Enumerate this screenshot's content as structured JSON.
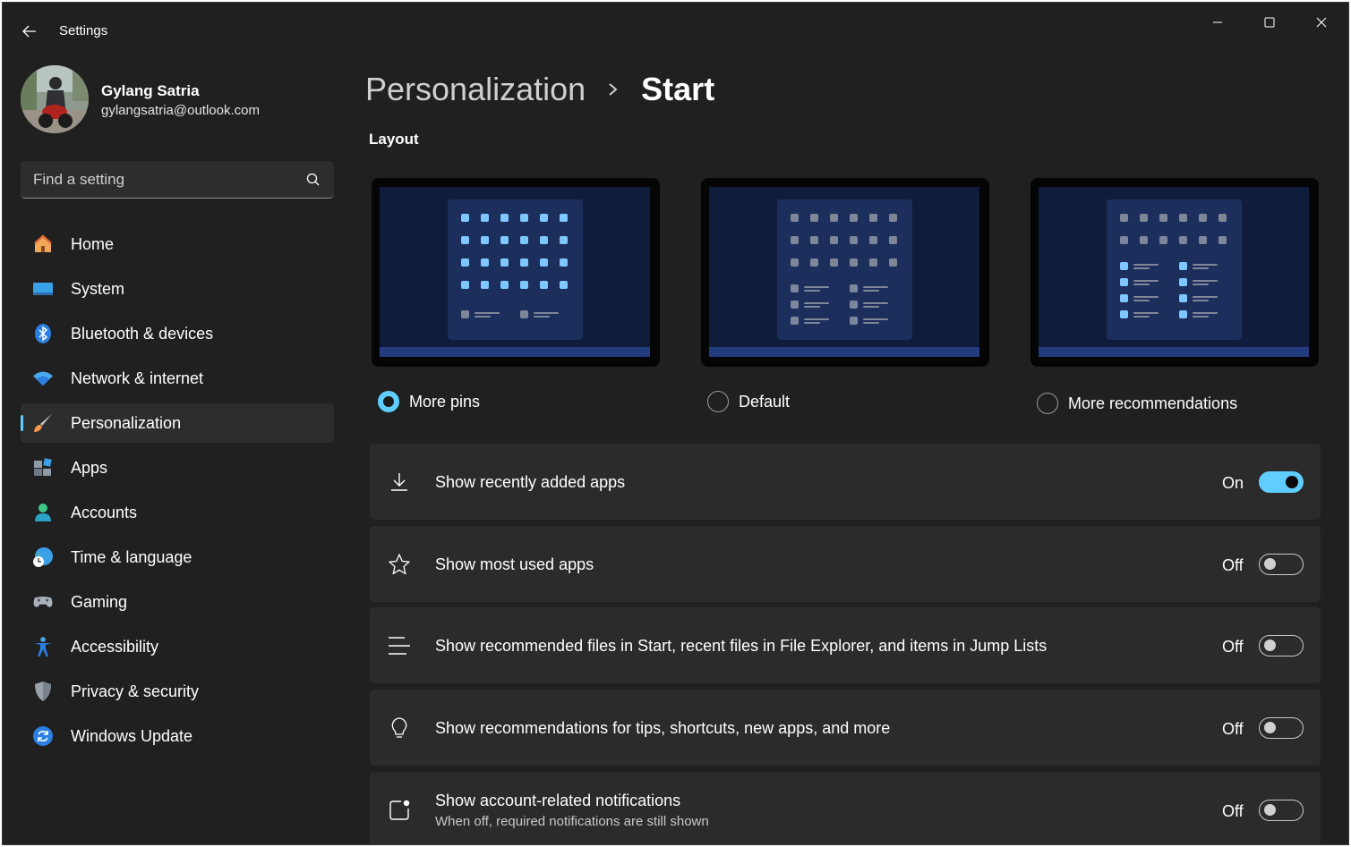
{
  "app": {
    "title": "Settings"
  },
  "profile": {
    "name": "Gylang Satria",
    "email": "gylangsatria@outlook.com"
  },
  "search": {
    "placeholder": "Find a setting"
  },
  "nav": {
    "selected": "Personalization",
    "items": [
      {
        "label": "Home",
        "icon": "home-icon"
      },
      {
        "label": "System",
        "icon": "system-icon"
      },
      {
        "label": "Bluetooth & devices",
        "icon": "bluetooth-icon"
      },
      {
        "label": "Network & internet",
        "icon": "wifi-icon"
      },
      {
        "label": "Personalization",
        "icon": "brush-icon"
      },
      {
        "label": "Apps",
        "icon": "apps-icon"
      },
      {
        "label": "Accounts",
        "icon": "accounts-icon"
      },
      {
        "label": "Time & language",
        "icon": "time-language-icon"
      },
      {
        "label": "Gaming",
        "icon": "gamepad-icon"
      },
      {
        "label": "Accessibility",
        "icon": "accessibility-icon"
      },
      {
        "label": "Privacy & security",
        "icon": "shield-icon"
      },
      {
        "label": "Windows Update",
        "icon": "windows-update-icon"
      }
    ]
  },
  "breadcrumb": {
    "parent": "Personalization",
    "current": "Start"
  },
  "layout": {
    "title": "Layout",
    "selected": "More pins",
    "options": [
      {
        "label": "More pins"
      },
      {
        "label": "Default"
      },
      {
        "label": "More recommendations"
      }
    ]
  },
  "settings": [
    {
      "title": "Show recently added apps",
      "state": "On",
      "icon": "download-icon"
    },
    {
      "title": "Show most used apps",
      "state": "Off",
      "icon": "star-icon"
    },
    {
      "title": "Show recommended files in Start, recent files in File Explorer, and items in Jump Lists",
      "state": "Off",
      "icon": "list-icon"
    },
    {
      "title": "Show recommendations for tips, shortcuts, new apps, and more",
      "state": "Off",
      "icon": "lightbulb-icon"
    },
    {
      "title": "Show account-related notifications",
      "description": "When off, required notifications are still shown",
      "state": "Off",
      "icon": "notification-icon"
    }
  ],
  "colors": {
    "accent": "#60cdff",
    "background": "#202020",
    "card": "#2b2b2b"
  }
}
